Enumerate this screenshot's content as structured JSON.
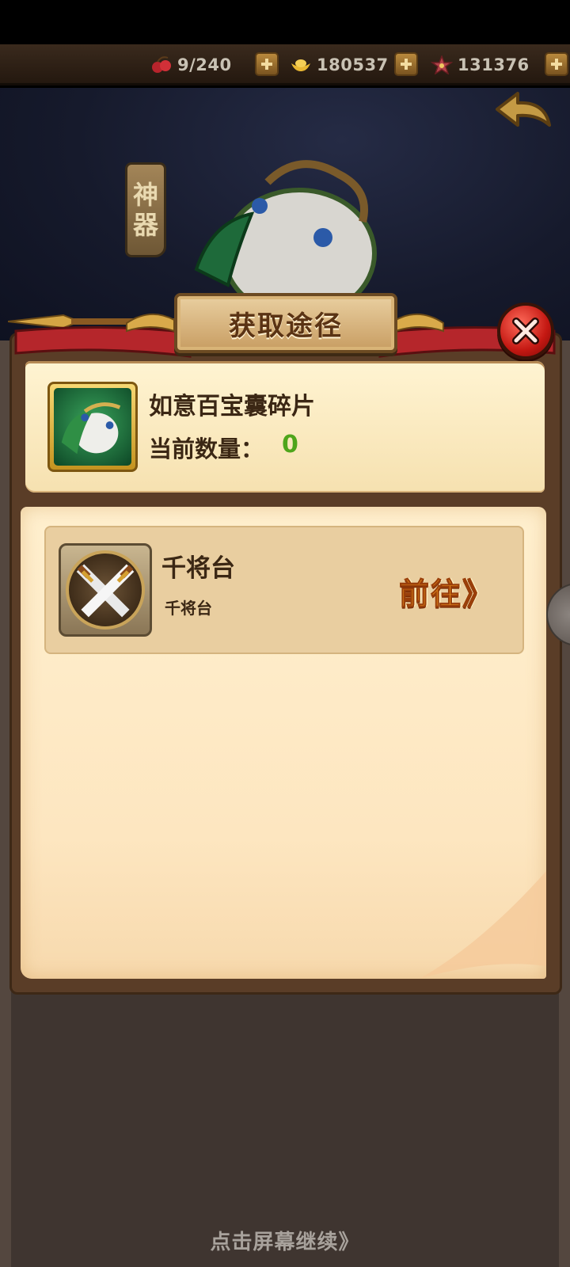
{
  "resources": {
    "stamina": {
      "icon": "cherries-icon",
      "value": "9/240"
    },
    "gold": {
      "icon": "gold-ingot-icon",
      "value": "180537"
    },
    "honor": {
      "icon": "star-badge-icon",
      "value": "131376"
    }
  },
  "scene": {
    "category_tag": [
      "神",
      "器"
    ]
  },
  "dialog": {
    "title": "获取途径",
    "item": {
      "name": "如意百宝囊碎片",
      "count_label": "当前数量：",
      "count_value": "0"
    },
    "sources": [
      {
        "icon": "crossed-swords-icon",
        "title": "千将台",
        "subtitle": "千将台",
        "action_label": "前往》"
      }
    ]
  },
  "footer": {
    "continue_hint": "点击屏幕继续》"
  },
  "colors": {
    "count_value": "#4ea51b",
    "goto_text": "#f29a1e",
    "close_button": "#c41812"
  }
}
